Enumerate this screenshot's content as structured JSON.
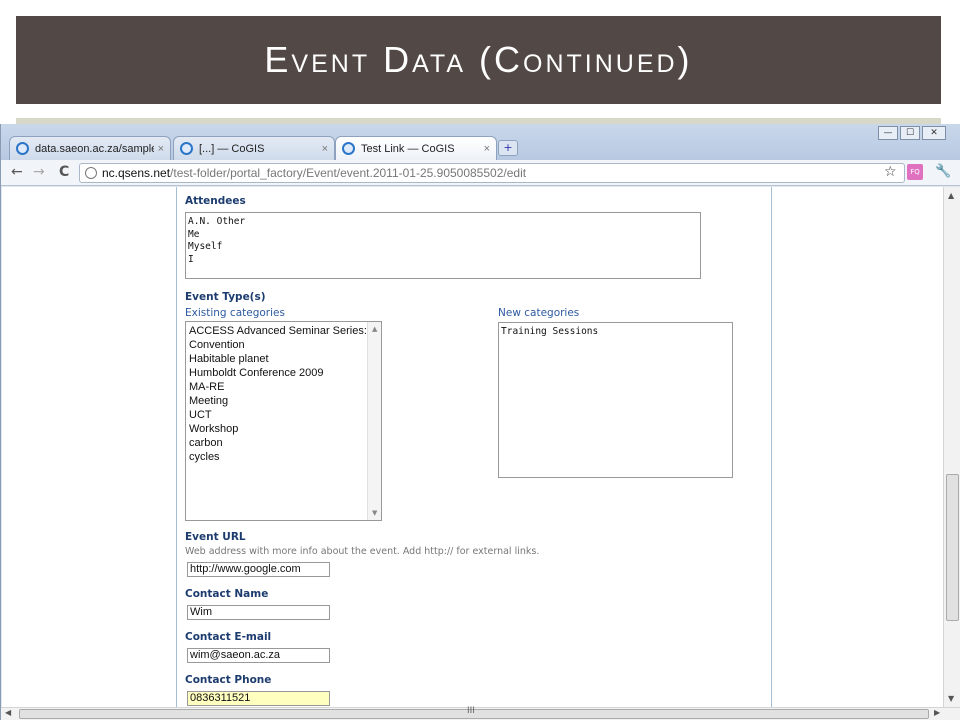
{
  "slide": {
    "title": "Event Data (Continued)"
  },
  "browser": {
    "tabs": [
      {
        "label": "data.saeon.ac.za/sample-..."
      },
      {
        "label": "[...] — CoGIS"
      },
      {
        "label": "Test Link — CoGIS"
      }
    ],
    "close_glyph": "×",
    "new_tab_glyph": "+",
    "window_controls": {
      "minimize": "—",
      "maximize": "☐",
      "close": "✕"
    },
    "toolbar": {
      "back": "←",
      "forward": "→",
      "reload": "C",
      "url_host": "nc.qsens.net",
      "url_path": "/test-folder/portal_factory/Event/event.2011-01-25.9050085502/edit",
      "star": "☆",
      "ext": "FQ",
      "wrench": "🔧"
    }
  },
  "form": {
    "attendees": {
      "label": "Attendees",
      "value": "A.N. Other\nMe\nMyself\nI"
    },
    "event_types": {
      "label": "Event Type(s)",
      "existing_label": "Existing categories",
      "new_label": "New categories",
      "existing": [
        "ACCESS Advanced Seminar Series:",
        "Convention",
        "Habitable planet",
        "Humboldt Conference 2009",
        "MA-RE",
        "Meeting",
        "UCT",
        "Workshop",
        "carbon",
        "cycles"
      ],
      "new_value": "Training Sessions"
    },
    "event_url": {
      "label": "Event URL",
      "help": "Web address with more info about the event. Add http:// for external links.",
      "value": "http://www.google.com"
    },
    "contact_name": {
      "label": "Contact Name",
      "value": "Wim"
    },
    "contact_email": {
      "label": "Contact E-mail",
      "value": "wim@saeon.ac.za"
    },
    "contact_phone": {
      "label": "Contact Phone",
      "value": "0836311521"
    }
  },
  "scrollbar": {
    "grip": "III",
    "up": "▲",
    "down": "▼",
    "left": "◀",
    "right": "▶"
  },
  "colors": {
    "title_bg": "#524845",
    "label": "#1c3b6e",
    "sublabel": "#2d5aa0",
    "highlight": "#ffffc0"
  }
}
